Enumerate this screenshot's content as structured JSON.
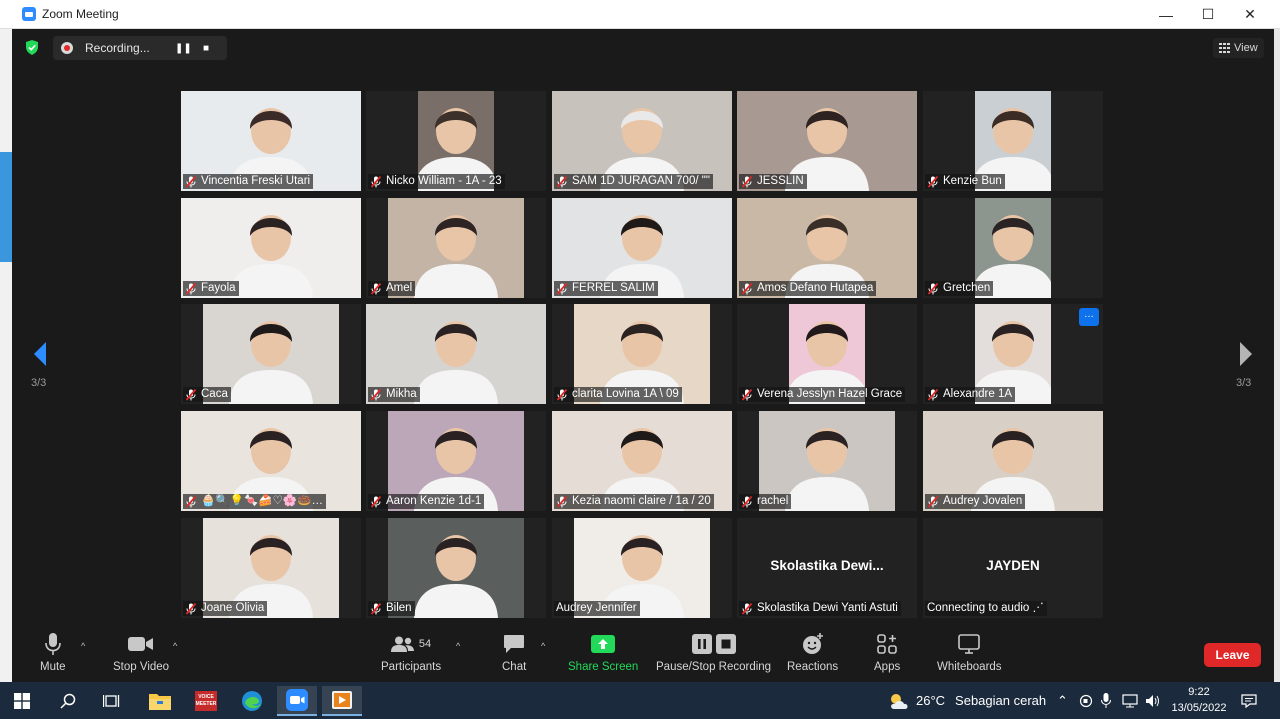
{
  "window": {
    "title": "Zoom Meeting",
    "accent": "#2d8cff"
  },
  "recording": {
    "label": "Recording..."
  },
  "view": {
    "label": "View"
  },
  "navigation": {
    "page_left": "3/3",
    "page_right": "3/3"
  },
  "participants": [
    {
      "name": "Vincentia Freski Utari",
      "muted": true,
      "video": true,
      "bg": "#e8ebed",
      "fg": "#3a2a28"
    },
    {
      "name": "Nicko William - 1A - 23",
      "muted": true,
      "video": true,
      "bg": "#7a6e68",
      "fg": "#3b302a"
    },
    {
      "name": "SAM 1D JURAGAN 700/ \"\"",
      "muted": true,
      "video": true,
      "bg": "#c7c2bc",
      "fg": "#e9e9e9"
    },
    {
      "name": "JESSLIN",
      "muted": true,
      "video": true,
      "bg": "#a89a92",
      "fg": "#2e2320"
    },
    {
      "name": "Kenzie Bun",
      "muted": true,
      "video": true,
      "bg": "#c9cfd3",
      "fg": "#3b2c26"
    },
    {
      "name": "Fayola",
      "muted": true,
      "video": true,
      "bg": "#f0eeed",
      "fg": "#2b2222"
    },
    {
      "name": "Amel",
      "muted": true,
      "video": true,
      "bg": "#c3b4a5",
      "fg": "#2e2424"
    },
    {
      "name": "FERREL SALIM",
      "muted": true,
      "video": true,
      "bg": "#e2e3e5",
      "fg": "#1f1a18"
    },
    {
      "name": "Amos Defano Hutapea",
      "muted": true,
      "video": true,
      "bg": "#c9b8a5",
      "fg": "#3a2f28"
    },
    {
      "name": "Gretchen",
      "muted": true,
      "video": true,
      "bg": "#8d958f",
      "fg": "#2a2424"
    },
    {
      "name": "Caca",
      "muted": true,
      "video": true,
      "bg": "#d9d6d2",
      "fg": "#1f1a1a"
    },
    {
      "name": "Mikha",
      "muted": true,
      "video": true,
      "bg": "#d6d4d0",
      "fg": "#2a2222"
    },
    {
      "name": "clarita Lovina 1A \\ 09",
      "muted": true,
      "video": true,
      "bg": "#e6d7c6",
      "fg": "#2b2222"
    },
    {
      "name": "Verena Jesslyn Hazel Grace",
      "muted": true,
      "video": true,
      "bg": "#efc8d8",
      "fg": "#221a1a"
    },
    {
      "name": "Alexandre 1A",
      "muted": true,
      "video": true,
      "bg": "#e3dedb",
      "fg": "#2a2222",
      "more": true
    },
    {
      "name": "🧁🔍💡🍬🍰♡🌸🍩…",
      "muted": true,
      "video": true,
      "bg": "#e9e4de",
      "fg": "#2a2222"
    },
    {
      "name": "Aaron Kenzie 1d-1",
      "muted": true,
      "video": true,
      "bg": "#bca7b8",
      "fg": "#2a2222"
    },
    {
      "name": "Kezia naomi claire / 1a / 20",
      "muted": true,
      "video": true,
      "bg": "#e5ddd5",
      "fg": "#1f1a1a"
    },
    {
      "name": "rachel",
      "muted": true,
      "video": true,
      "bg": "#cbc6c2",
      "fg": "#2a2222"
    },
    {
      "name": "Audrey Jovalen",
      "muted": true,
      "video": true,
      "bg": "#d8cfc6",
      "fg": "#2a2222"
    },
    {
      "name": "Joane Olivia",
      "muted": true,
      "video": true,
      "bg": "#e6e1db",
      "fg": "#2a2222"
    },
    {
      "name": "Bilen",
      "muted": true,
      "video": true,
      "bg": "#5a5e5c",
      "fg": "#2a2222"
    },
    {
      "name": "Audrey Jennifer",
      "muted": false,
      "video": true,
      "bg": "#f0ece8",
      "fg": "#2a2222"
    },
    {
      "name": "Skolastika Dewi Yanti Astuti",
      "display_name": "Skolastika  Dewi...",
      "muted": true,
      "video": false
    },
    {
      "name": "Connecting to audio ⋰",
      "display_name": "JAYDEN",
      "muted": false,
      "video": false
    }
  ],
  "toolbar": {
    "mute": "Mute",
    "stop_video": "Stop Video",
    "participants": "Participants",
    "participant_count": "54",
    "chat": "Chat",
    "share_screen": "Share Screen",
    "share_color": "#23d959",
    "pause_recording": "Pause/Stop Recording",
    "reactions": "Reactions",
    "apps": "Apps",
    "whiteboards": "Whiteboards",
    "leave": "Leave",
    "leave_color": "#e02828"
  },
  "taskbar": {
    "apps": [
      "windows-start",
      "search",
      "task-view",
      "file-explorer",
      "voice-meeter",
      "edge",
      "zoom",
      "media-player"
    ],
    "voicemeeter_label": "VOICE MEETER",
    "weather_temp": "26°C",
    "weather_desc": "Sebagian cerah",
    "time": "9:22",
    "date": "13/05/2022"
  }
}
